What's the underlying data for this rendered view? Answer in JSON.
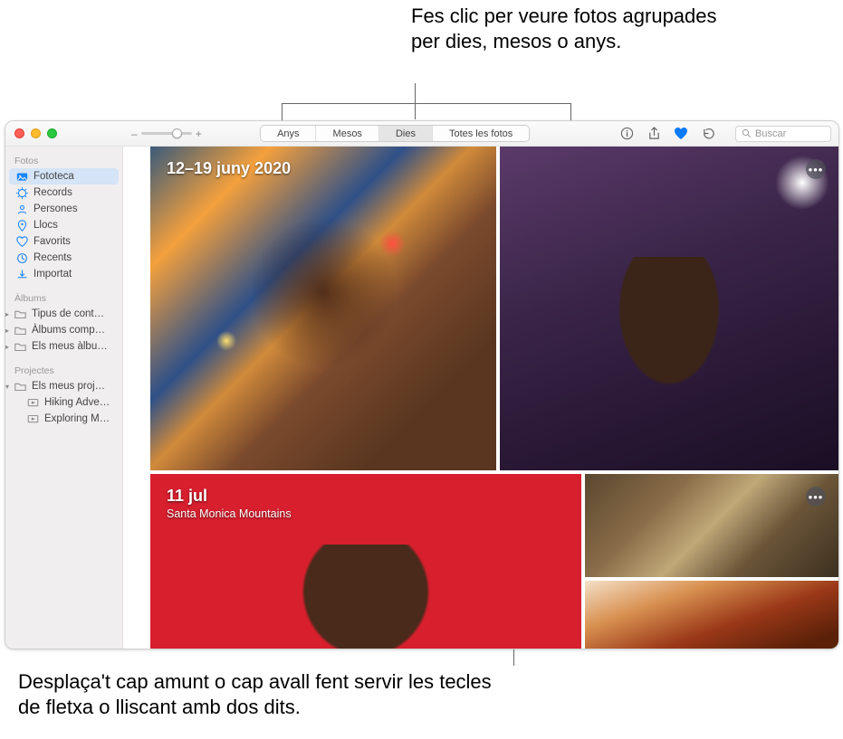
{
  "callouts": {
    "top": "Fes clic per veure fotos agrupades per dies, mesos o anys.",
    "bottom": "Desplaça't cap amunt o cap avall fent servir les tecles de fletxa o lliscant amb dos dits."
  },
  "toolbar": {
    "zoom_minus": "–",
    "zoom_plus": "+",
    "tabs": {
      "years": "Anys",
      "months": "Mesos",
      "days": "Dies",
      "all": "Totes les fotos"
    },
    "search_placeholder": "Buscar"
  },
  "sidebar": {
    "section_photos": "Fotos",
    "items_photos": [
      {
        "label": "Fototeca"
      },
      {
        "label": "Records"
      },
      {
        "label": "Persones"
      },
      {
        "label": "Llocs"
      },
      {
        "label": "Favorits"
      },
      {
        "label": "Recents"
      },
      {
        "label": "Importat"
      }
    ],
    "section_albums": "Àlbums",
    "items_albums": [
      {
        "label": "Tipus de cont…"
      },
      {
        "label": "Àlbums comp…"
      },
      {
        "label": "Els meus àlbu…"
      }
    ],
    "section_projects": "Projectes",
    "items_projects": [
      {
        "label": "Els meus proj…"
      },
      {
        "label": "Hiking Adve…"
      },
      {
        "label": "Exploring M…"
      }
    ]
  },
  "groups": [
    {
      "title": "12–19 juny 2020",
      "subtitle": ""
    },
    {
      "title": "11 jul",
      "subtitle": "Santa Monica Mountains"
    }
  ],
  "more_glyph": "•••"
}
